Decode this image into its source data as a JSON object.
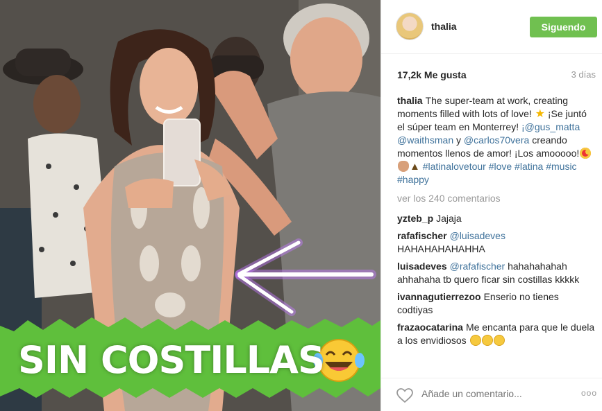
{
  "photo": {
    "overlay_text": "SIN COSTILLAS"
  },
  "post": {
    "username": "thalia",
    "follow_label": "Siguendo",
    "likes": "17,2k Me gusta",
    "time_ago": "3 días"
  },
  "caption": {
    "author": "thalia",
    "text_1": "The super-team at work, creating moments filled with lots of love!",
    "text_2": "¡Se juntó el súper team en Monterrey!",
    "mention_1": "¡@gus_matta",
    "mention_2": "@waithsman",
    "and_word": "y",
    "mention_3": "@carlos70vera",
    "text_3": "creando momentos llenos de amor! ¡Los amooooo!",
    "hashtags": "#latinalovetour #love #latina #music #happy"
  },
  "view_all": "ver los 240 comentarios",
  "comments": [
    {
      "author": "yzteb_p",
      "mention": "",
      "text": "Jajaja"
    },
    {
      "author": "rafafischer",
      "mention": "@luisadeves",
      "text": "HAHAHAHAHAHHA"
    },
    {
      "author": "luisadeves",
      "mention": "@rafafischer",
      "text": "hahahahahah ahhahaha tb quero ficar sin costillas kkkkk"
    },
    {
      "author": "ivannagutierrezoo",
      "mention": "",
      "text": "Enserio no tienes codtiyas"
    },
    {
      "author": "frazaocatarina",
      "mention": "",
      "text": "Me encanta para que le duela a los envidiosos"
    }
  ],
  "footer": {
    "placeholder": "Añade un comentario...",
    "more": "ooo"
  },
  "colors": {
    "follow": "#70c050",
    "link": "#3f729b",
    "overlay_green": "#5fbf3c",
    "arrow_purple": "#b43cff"
  },
  "icons": [
    "star-emoji",
    "heart-eyes-emoji",
    "clap-emoji",
    "party-popper-emoji",
    "laughing-tears-emoji",
    "heart-icon",
    "more-options-icon"
  ]
}
